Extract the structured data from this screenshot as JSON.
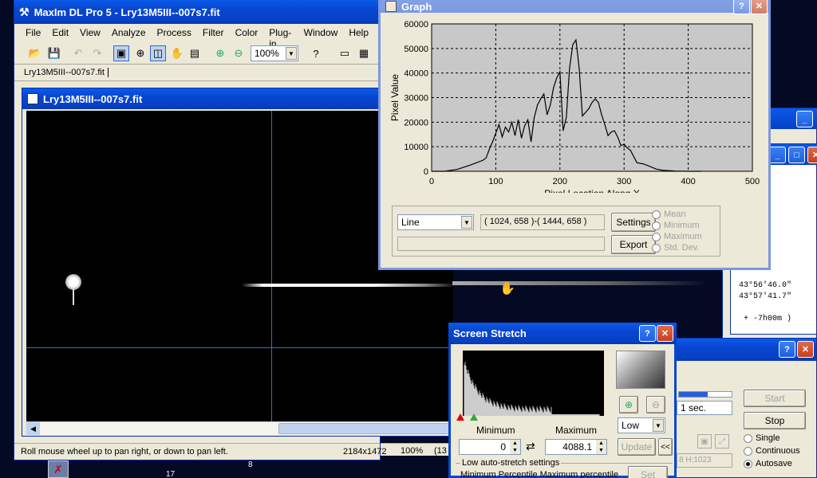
{
  "main_window": {
    "title": "MaxIm DL Pro 5 - Lry13M5III--007s7.fit",
    "menu": [
      "File",
      "Edit",
      "View",
      "Analyze",
      "Process",
      "Filter",
      "Color",
      "Plug-in",
      "Window",
      "Help"
    ],
    "zoom": "100%",
    "tab": "Lry13M5III--007s7.fit",
    "status": "Roll mouse wheel up to pan right, or down to pan left.",
    "status_size": "2184x1472",
    "status_zoom": "100%",
    "status_extra": "(13"
  },
  "image_window": {
    "title": "Lry13M5III--007s7.fit"
  },
  "graph": {
    "title": "Graph",
    "mode": "Line",
    "coords": "( 1024, 658 )-( 1444, 658 )",
    "settings_label": "Settings",
    "export_label": "Export",
    "radios": [
      "Mean",
      "Minimum",
      "Maximum",
      "Std. Dev."
    ]
  },
  "chart_data": {
    "type": "line",
    "xlabel": "Pixel Location Along X",
    "ylabel": "Pixel Value",
    "xlim": [
      0,
      500
    ],
    "ylim": [
      0,
      60000
    ],
    "xticks": [
      "0",
      "100",
      "200",
      "300",
      "400",
      "500"
    ],
    "yticks": [
      "0",
      "10000",
      "20000",
      "30000",
      "40000",
      "50000",
      "60000"
    ],
    "grid": true,
    "x": [
      0,
      20,
      40,
      60,
      80,
      85,
      90,
      95,
      100,
      105,
      110,
      115,
      120,
      125,
      130,
      135,
      140,
      145,
      150,
      155,
      160,
      165,
      170,
      175,
      180,
      185,
      190,
      195,
      200,
      205,
      210,
      215,
      220,
      225,
      230,
      235,
      240,
      245,
      250,
      255,
      260,
      265,
      270,
      275,
      280,
      285,
      290,
      295,
      300,
      305,
      310,
      320,
      330,
      340,
      350,
      360,
      380,
      400,
      420
    ],
    "y": [
      0,
      0,
      800,
      2500,
      4500,
      5500,
      9000,
      12000,
      15500,
      19000,
      14000,
      18000,
      16000,
      20000,
      14500,
      21000,
      13500,
      18500,
      21000,
      12000,
      22000,
      27000,
      29500,
      31500,
      23000,
      27000,
      34000,
      38000,
      40500,
      16500,
      22000,
      42000,
      51500,
      53500,
      42000,
      22500,
      24000,
      25500,
      28000,
      29500,
      28000,
      23000,
      19000,
      14500,
      16000,
      16500,
      14000,
      10500,
      11000,
      9500,
      8500,
      3500,
      3000,
      2000,
      900,
      400,
      100,
      0,
      0
    ]
  },
  "stretch": {
    "title": "Screen Stretch",
    "min_label": "Minimum",
    "max_label": "Maximum",
    "min_value": "0",
    "max_value": "4088.1",
    "preset": "Low",
    "update_label": "Update",
    "more_label": "<<",
    "group_label": "Low auto-stretch settings",
    "pct_label": "Minimum Percentile Maximum percentile",
    "set_label": "Set"
  },
  "camera": {
    "progress": 0.55,
    "exposure": "1 sec.",
    "start_label": "Start",
    "stop_label": "Stop",
    "radios": [
      "Single",
      "Continuous",
      "Autosave"
    ],
    "selected": "Autosave",
    "readout": "8 H:1023"
  },
  "coords_panel": {
    "lines": [
      "43°56'46.0\"",
      "43°57'41.7\"",
      "+  -7h00m )"
    ]
  },
  "chart_bottom": {
    "labels": [
      "8",
      "17"
    ]
  }
}
